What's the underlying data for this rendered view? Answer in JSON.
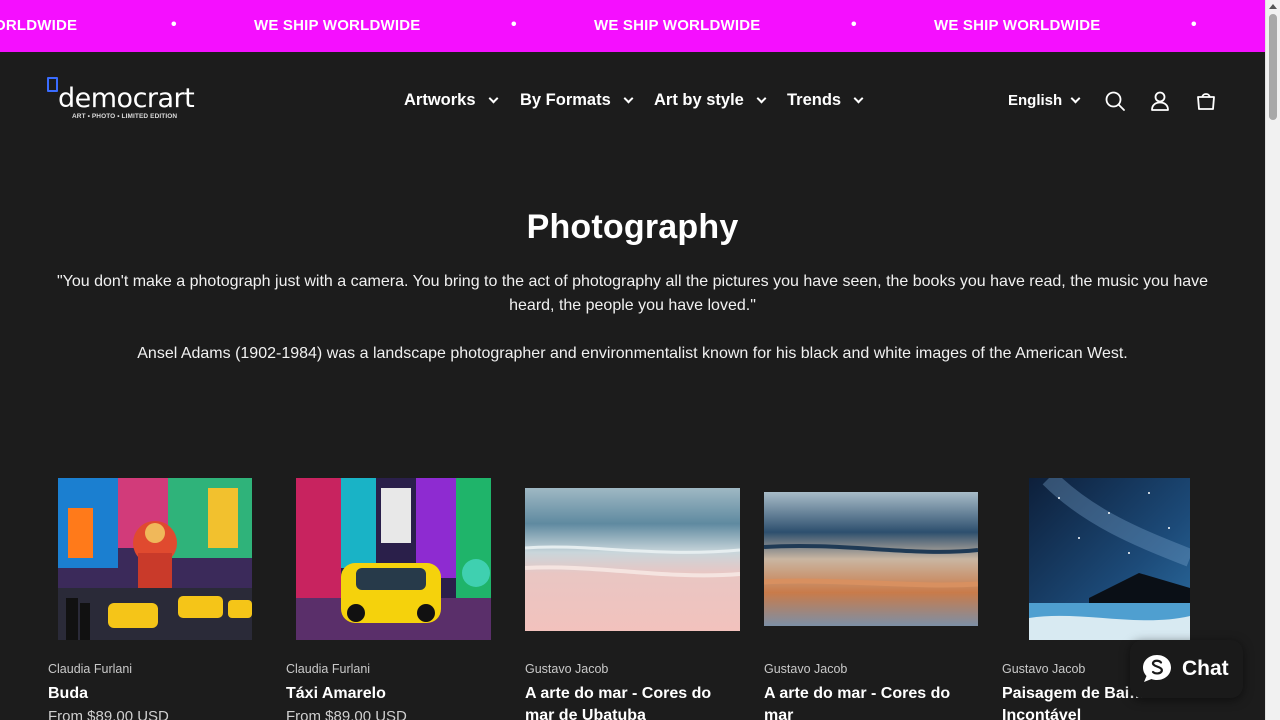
{
  "announcement": {
    "text": "WE SHIP WORLDWIDE",
    "text_cut": "ORLDWIDE",
    "separator": "•",
    "background": "#f50fff"
  },
  "logo": {
    "wordmark": "democrart",
    "tagline": "ART • PHOTO • LIMITED EDITION",
    "accent": "#3a6cff"
  },
  "nav": {
    "items": [
      {
        "label": "Artworks"
      },
      {
        "label": "By Formats"
      },
      {
        "label": "Art by style"
      },
      {
        "label": "Trends"
      }
    ]
  },
  "header_actions": {
    "language": "English",
    "icons": [
      "search-icon",
      "account-icon",
      "cart-icon"
    ]
  },
  "collection": {
    "title": "Photography",
    "quote": "\"You don't make a photograph just with a camera. You bring to the act of photography all the pictures you have seen, the books you have read, the music you have heard, the people you have loved.\"",
    "bio": "Ansel Adams (1902-1984) was a landscape photographer and environmentalist known for his black and white images of the American West."
  },
  "products": [
    {
      "artist": "Claudia Furlani",
      "title": "Buda",
      "price": "From $89.00 USD"
    },
    {
      "artist": "Claudia Furlani",
      "title": "Táxi Amarelo",
      "price": "From $89.00 USD"
    },
    {
      "artist": "Gustavo Jacob",
      "title": "A arte do mar - Cores do mar de Ubatuba",
      "price": ""
    },
    {
      "artist": "Gustavo Jacob",
      "title": "A arte do mar - Cores do mar",
      "price": ""
    },
    {
      "artist": "Gustavo Jacob",
      "title": "Paisagem de Bai… Beleza Incontável",
      "price": ""
    }
  ],
  "chat": {
    "label": "Chat"
  }
}
